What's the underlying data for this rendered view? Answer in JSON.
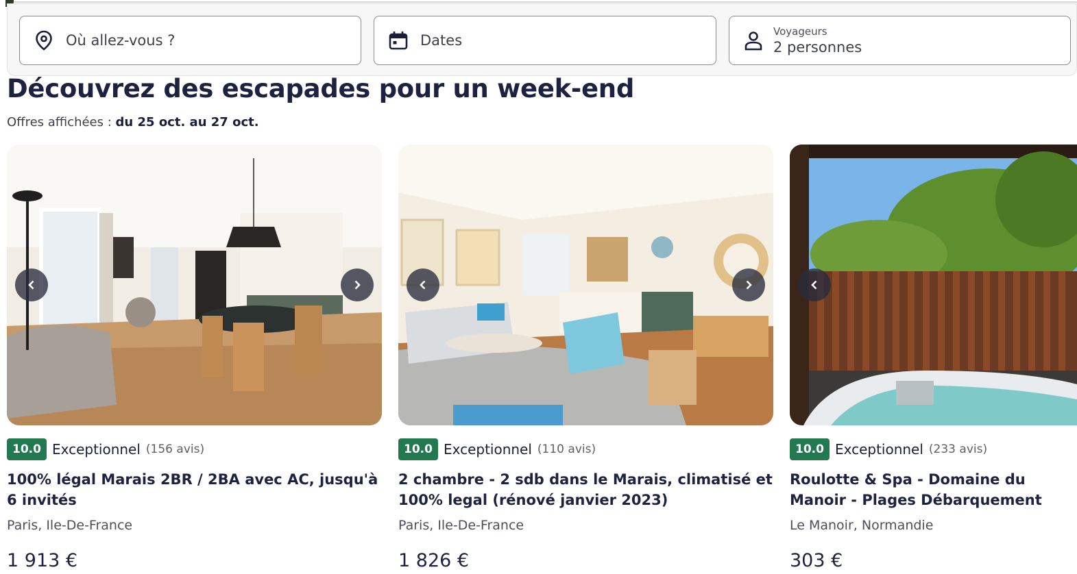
{
  "search": {
    "destination_placeholder": "Où allez-vous ?",
    "dates_label": "Dates",
    "travelers_label": "Voyageurs",
    "travelers_value": "2 personnes",
    "icons": [
      "location-pin-icon",
      "calendar-icon",
      "person-icon"
    ]
  },
  "section": {
    "title": "Découvrez des escapades pour un week-end",
    "subtitle_prefix": "Offres affichées : ",
    "subtitle_dates": "du 25 oct. au 27 oct."
  },
  "colors": {
    "badge": "#227950",
    "text": "#191e3b",
    "nav_button": "#282c3e"
  },
  "cards": [
    {
      "score": "10.0",
      "rating": "Exceptionnel",
      "reviews": "(156 avis)",
      "name": "100% légal Marais 2BR / 2BA avec AC, jusqu'à 6 invités",
      "location": "Paris, Ile-De-France",
      "price": "1 913 €"
    },
    {
      "score": "10.0",
      "rating": "Exceptionnel",
      "reviews": "(110 avis)",
      "name": "2 chambre - 2 sdb dans le Marais, climatisé et 100% legal (rénové janvier 2023)",
      "location": "Paris, Ile-De-France",
      "price": "1 826 €"
    },
    {
      "score": "10.0",
      "rating": "Exceptionnel",
      "reviews": "(233 avis)",
      "name": "Roulotte & Spa - Domaine du Manoir - Plages Débarquement",
      "location": "Le Manoir, Normandie",
      "price": "303 €"
    }
  ]
}
